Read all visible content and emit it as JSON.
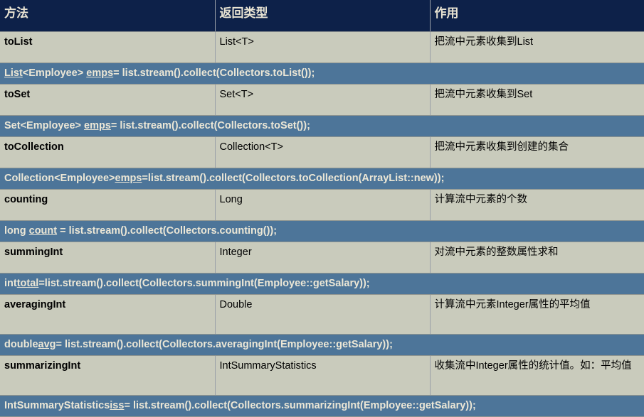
{
  "table": {
    "columns": [
      {
        "key": "method",
        "label": "方法"
      },
      {
        "key": "return_type",
        "label": "返回类型"
      },
      {
        "key": "description",
        "label": "作用"
      }
    ],
    "colors": {
      "header_bg": "#0d2149",
      "header_text": "#e9e4d3",
      "row_bg": "#c9cbbc",
      "row_text": "#000000",
      "code_bg": "#4d7599",
      "code_text": "#ece7d6",
      "grid_line": "#8e9490"
    },
    "rows": [
      {
        "method": "toList",
        "return_type": "List<T>",
        "description": "把流中元素收集到List",
        "code": {
          "full": "List<Employee> emps= list.stream().collect(Collectors.toList());",
          "parts": [
            {
              "text": "List",
              "underline": true
            },
            {
              "text": "<Employee> ",
              "underline": false
            },
            {
              "text": "emps",
              "underline": true
            },
            {
              "text": "= list.stream().collect(Collectors.toList());",
              "underline": false
            }
          ]
        }
      },
      {
        "method": "toSet",
        "return_type": "Set<T>",
        "description": "把流中元素收集到Set",
        "code": {
          "full": "Set<Employee> emps= list.stream().collect(Collectors.toSet());",
          "parts": [
            {
              "text": "Set<Employee> ",
              "underline": false
            },
            {
              "text": "emps",
              "underline": true
            },
            {
              "text": "= list.stream().collect(Collectors.toSet());",
              "underline": false
            }
          ]
        }
      },
      {
        "method": "toCollection",
        "return_type": "Collection<T>",
        "description": "把流中元素收集到创建的集合",
        "code": {
          "full": "Collection<Employee>emps=list.stream().collect(Collectors.toCollection(ArrayList::new));",
          "parts": [
            {
              "text": "Collection<Employee>",
              "underline": false
            },
            {
              "text": "emps",
              "underline": true
            },
            {
              "text": "=list.stream().collect(Collectors.toCollection(ArrayList::new));",
              "underline": false
            }
          ]
        }
      },
      {
        "method": "counting",
        "return_type": "Long",
        "description": "计算流中元素的个数",
        "code": {
          "full": "long count = list.stream().collect(Collectors.counting());",
          "parts": [
            {
              "text": "long ",
              "underline": false
            },
            {
              "text": "count",
              "underline": true
            },
            {
              "text": " = list.stream().collect(Collectors.counting());",
              "underline": false
            }
          ]
        }
      },
      {
        "method": "summingInt",
        "return_type": "Integer",
        "description": "对流中元素的整数属性求和",
        "code": {
          "full": "inttotal=list.stream().collect(Collectors.summingInt(Employee::getSalary));",
          "parts": [
            {
              "text": "int",
              "underline": false
            },
            {
              "text": "total",
              "underline": true
            },
            {
              "text": "=list.stream().collect(Collectors.summingInt(Employee::getSalary));",
              "underline": false
            }
          ]
        }
      },
      {
        "method": "averagingInt",
        "return_type": "Double",
        "description": "计算流中元素Integer属性的平均值",
        "code": {
          "full": "doubleavg= list.stream().collect(Collectors.averagingInt(Employee::getSalary));",
          "parts": [
            {
              "text": "double",
              "underline": false
            },
            {
              "text": "avg",
              "underline": true
            },
            {
              "text": "= list.stream().collect(Collectors.averagingInt(Employee::getSalary));",
              "underline": false
            }
          ]
        }
      },
      {
        "method": "summarizingInt",
        "return_type": "IntSummaryStatistics",
        "description": "收集流中Integer属性的统计值。如：平均值",
        "code": {
          "full": "IntSummaryStatisticsiss= list.stream().collect(Collectors.summarizingInt(Employee::getSalary));",
          "parts": [
            {
              "text": "IntSummaryStatistics",
              "underline": false
            },
            {
              "text": "iss",
              "underline": true
            },
            {
              "text": "= list.stream().collect(Collectors.summarizingInt(Employee::getSalary));",
              "underline": false
            }
          ]
        }
      }
    ]
  }
}
